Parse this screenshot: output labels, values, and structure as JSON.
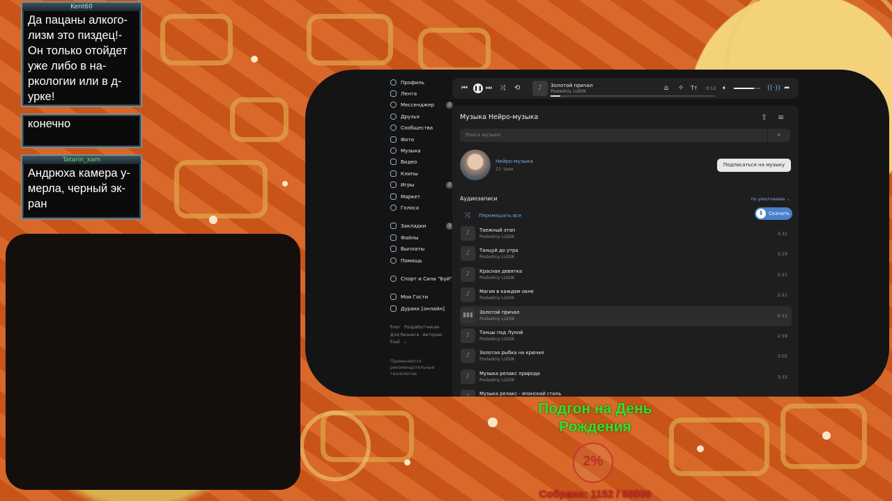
{
  "chat": [
    {
      "user": "Kent60",
      "text": "Да пацаны алкого-лизм это пиздец!-Он только отойдет уже либо в на-ркологии или в д-урке!"
    },
    {
      "user": "",
      "text": "конечно"
    },
    {
      "user": "Tatarin_xam",
      "text": "Андрюха камера у-мерла, черный эк-ран"
    }
  ],
  "nav": {
    "items": [
      {
        "label": "Профиль",
        "badge": ""
      },
      {
        "label": "Лента",
        "badge": ""
      },
      {
        "label": "Мессенджер",
        "badge": "2"
      },
      {
        "label": "Друзья",
        "badge": ""
      },
      {
        "label": "Сообщества",
        "badge": ""
      },
      {
        "label": "Фото",
        "badge": ""
      },
      {
        "label": "Музыка",
        "badge": ""
      },
      {
        "label": "Видео",
        "badge": ""
      },
      {
        "label": "Клипы",
        "badge": ""
      },
      {
        "label": "Игры",
        "badge": "2"
      },
      {
        "label": "Маркет",
        "badge": ""
      },
      {
        "label": "Голоса",
        "badge": ""
      }
    ],
    "items2": [
      {
        "label": "Закладки",
        "badge": "3"
      },
      {
        "label": "Файлы",
        "badge": ""
      },
      {
        "label": "Выплаты",
        "badge": ""
      },
      {
        "label": "Помощь",
        "badge": ""
      }
    ],
    "community": "Спорт и Сила \"Буй\"",
    "items3": [
      {
        "label": "Мои Гости"
      },
      {
        "label": "Дуракк [онлайн]"
      }
    ],
    "footer_links": [
      "блог",
      "Разработчикам",
      "Для бизнеса",
      "Авторам",
      "Ещё"
    ],
    "footer_note": "Применяются рекомендательные технологии"
  },
  "player": {
    "title": "Золотой причал",
    "artist": "Posledniy LUDIK",
    "time": "0:12",
    "progress": 0.06,
    "volume": 0.75
  },
  "music": {
    "title": "Музыка Нейро-музыка",
    "search_placeholder": "Поиск музыки",
    "playlist_name": "Нейро-музыка",
    "playlist_count": "21 трек",
    "subscribe": "Подписаться на музыку",
    "audio_label": "Аудиозаписи",
    "sort": "по умолчанию",
    "shuffle": "Перемешать все",
    "download": "Скачать",
    "tracks": [
      {
        "title": "Таежный этап",
        "artist": "Posledniy LUDIK",
        "duration": "3:31",
        "active": false
      },
      {
        "title": "Танцуй до утра",
        "artist": "Posledniy LUDIK",
        "duration": "3:19",
        "active": false
      },
      {
        "title": "Красная девятка",
        "artist": "Posledniy LUDIK",
        "duration": "3:21",
        "active": false
      },
      {
        "title": "Магия в каждом окне",
        "artist": "Posledniy LUDIK",
        "duration": "2:21",
        "active": false
      },
      {
        "title": "Золотой причал",
        "artist": "Posledniy LUDIK",
        "duration": "0:12",
        "active": true
      },
      {
        "title": "Танцы под Луной",
        "artist": "Posledniy LUDIK",
        "duration": "2:59",
        "active": false
      },
      {
        "title": "Золотая рыбка на крючке",
        "artist": "Posledniy LUDIK",
        "duration": "3:05",
        "active": false
      },
      {
        "title": "Музыка релакс природа",
        "artist": "Posledniy LUDIK",
        "duration": "3:33",
        "active": false
      },
      {
        "title": "Музыка релакс - японский стиль",
        "artist": "",
        "duration": "",
        "active": false
      }
    ]
  },
  "goal": {
    "title": "Подгон на День Рождения",
    "percent": "2%",
    "collected": "Собрано: 1152 / 50000"
  },
  "colors": {
    "accent": "#71aaeb",
    "goal_green": "#3ddc2a",
    "goal_red": "#d42a25"
  }
}
